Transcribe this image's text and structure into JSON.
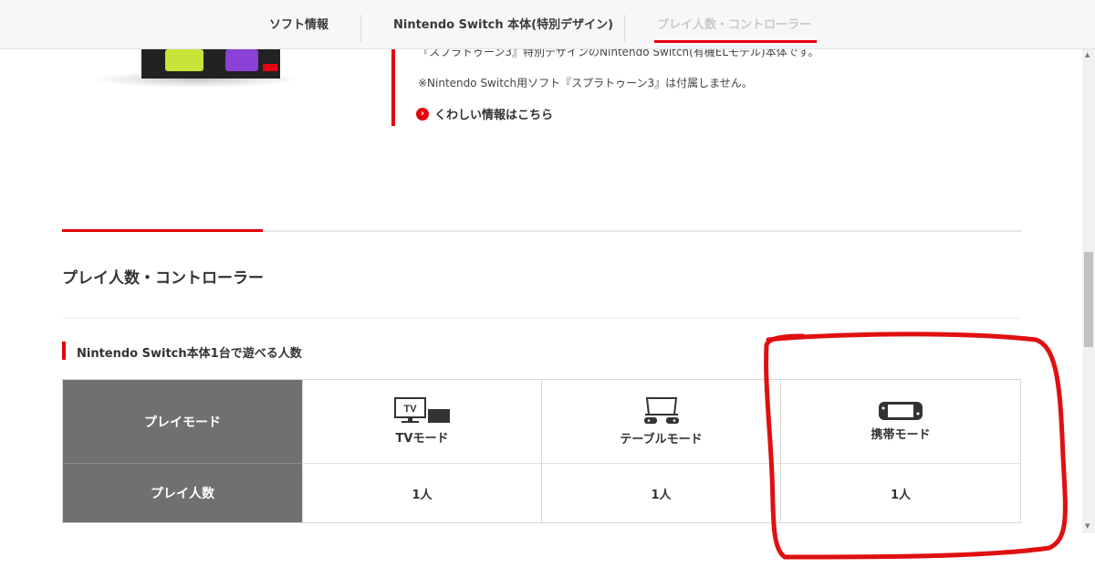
{
  "nav": {
    "items": [
      {
        "label": "ソフト情報"
      },
      {
        "label": "Nintendo Switch 本体(特別デザイン)"
      },
      {
        "label": "プレイ人数・コントローラー"
      }
    ]
  },
  "product": {
    "desc_line1": "『スプラトゥーン3』特別デザインのNintendo Switch(有機ELモデル)本体です。",
    "desc_line2": "※Nintendo Switch用ソフト『スプラトゥーン3』は付属しません。",
    "more_link": "くわしい情報はこちら"
  },
  "section": {
    "title": "プレイ人数・コントローラー",
    "subtitle": "Nintendo Switch本体1台で遊べる人数"
  },
  "table": {
    "row_headers": [
      "プレイモード",
      "プレイ人数"
    ],
    "modes": [
      {
        "label": "TVモード",
        "icon": "tv-mode-icon",
        "players": "1人"
      },
      {
        "label": "テーブルモード",
        "icon": "tabletop-mode-icon",
        "players": "1人"
      },
      {
        "label": "携帯モード",
        "icon": "handheld-mode-icon",
        "players": "1人"
      }
    ]
  },
  "colors": {
    "accent": "#e4000f",
    "table_header_bg": "#707070",
    "annotation": "#e01010"
  }
}
